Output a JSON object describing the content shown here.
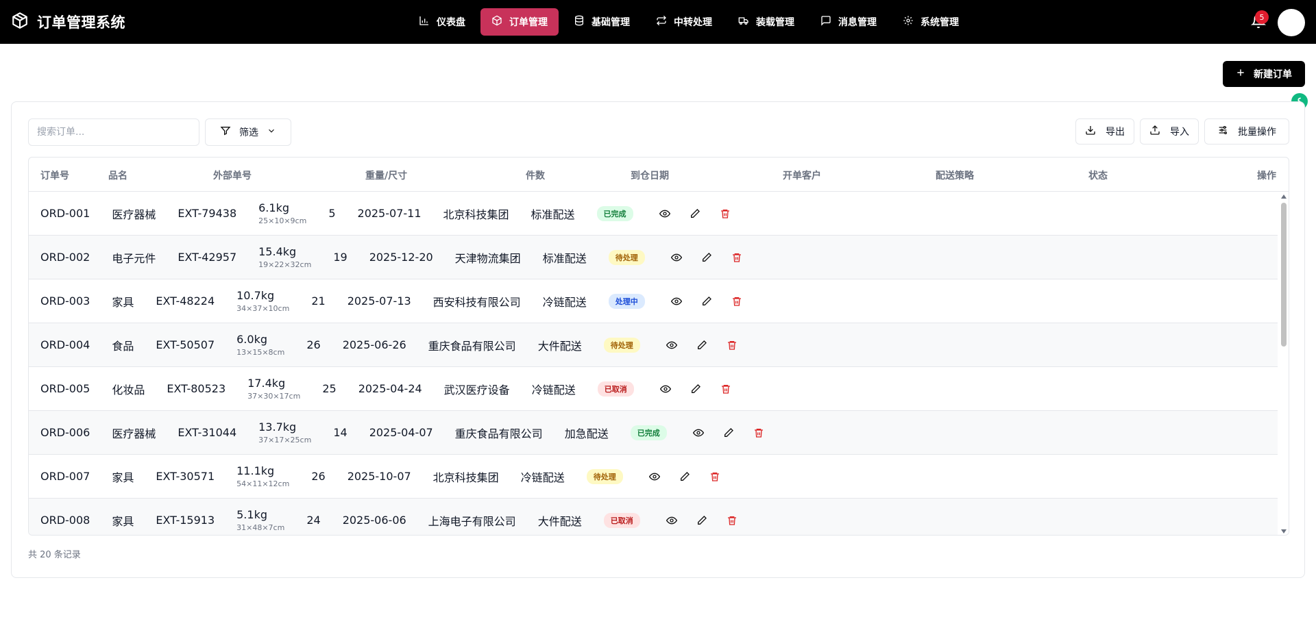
{
  "app": {
    "title": "订单管理系统"
  },
  "nav": [
    {
      "label": "仪表盘",
      "icon": "bar-chart-icon",
      "active": false
    },
    {
      "label": "订单管理",
      "icon": "box-icon",
      "active": true
    },
    {
      "label": "基础管理",
      "icon": "database-icon",
      "active": false
    },
    {
      "label": "中转处理",
      "icon": "transfer-icon",
      "active": false
    },
    {
      "label": "装载管理",
      "icon": "truck-icon",
      "active": false
    },
    {
      "label": "消息管理",
      "icon": "message-icon",
      "active": false
    },
    {
      "label": "系统管理",
      "icon": "gear-icon",
      "active": false
    }
  ],
  "notifications": {
    "count": "5"
  },
  "actions": {
    "new_order": "新建订单"
  },
  "toolbar": {
    "search_placeholder": "搜索订单...",
    "filter": "筛选",
    "export": "导出",
    "import": "导入",
    "batch": "批量操作"
  },
  "table": {
    "headers": [
      "订单号",
      "品名",
      "外部单号",
      "重量/尺寸",
      "件数",
      "到仓日期",
      "开单客户",
      "配送策略",
      "状态",
      "操作"
    ],
    "rows": [
      {
        "id": "ORD-001",
        "name": "医疗器械",
        "ext": "EXT-79438",
        "weight": "6.1kg",
        "dims": "25×10×9cm",
        "qty": "5",
        "date": "2025-07-11",
        "customer": "北京科技集团",
        "strategy": "标准配送",
        "status": "已完成",
        "status_type": "done"
      },
      {
        "id": "ORD-002",
        "name": "电子元件",
        "ext": "EXT-42957",
        "weight": "15.4kg",
        "dims": "19×22×32cm",
        "qty": "19",
        "date": "2025-12-20",
        "customer": "天津物流集团",
        "strategy": "标准配送",
        "status": "待处理",
        "status_type": "wait"
      },
      {
        "id": "ORD-003",
        "name": "家具",
        "ext": "EXT-48224",
        "weight": "10.7kg",
        "dims": "34×37×10cm",
        "qty": "21",
        "date": "2025-07-13",
        "customer": "西安科技有限公司",
        "strategy": "冷链配送",
        "status": "处理中",
        "status_type": "proc"
      },
      {
        "id": "ORD-004",
        "name": "食品",
        "ext": "EXT-50507",
        "weight": "6.0kg",
        "dims": "13×15×8cm",
        "qty": "26",
        "date": "2025-06-26",
        "customer": "重庆食品有限公司",
        "strategy": "大件配送",
        "status": "待处理",
        "status_type": "wait"
      },
      {
        "id": "ORD-005",
        "name": "化妆品",
        "ext": "EXT-80523",
        "weight": "17.4kg",
        "dims": "37×30×17cm",
        "qty": "25",
        "date": "2025-04-24",
        "customer": "武汉医疗设备",
        "strategy": "冷链配送",
        "status": "已取消",
        "status_type": "cancel"
      },
      {
        "id": "ORD-006",
        "name": "医疗器械",
        "ext": "EXT-31044",
        "weight": "13.7kg",
        "dims": "37×17×25cm",
        "qty": "14",
        "date": "2025-04-07",
        "customer": "重庆食品有限公司",
        "strategy": "加急配送",
        "status": "已完成",
        "status_type": "done"
      },
      {
        "id": "ORD-007",
        "name": "家具",
        "ext": "EXT-30571",
        "weight": "11.1kg",
        "dims": "54×11×12cm",
        "qty": "26",
        "date": "2025-10-07",
        "customer": "北京科技集团",
        "strategy": "冷链配送",
        "status": "待处理",
        "status_type": "wait"
      },
      {
        "id": "ORD-008",
        "name": "家具",
        "ext": "EXT-15913",
        "weight": "5.1kg",
        "dims": "31×48×7cm",
        "qty": "24",
        "date": "2025-06-06",
        "customer": "上海电子有限公司",
        "strategy": "大件配送",
        "status": "已取消",
        "status_type": "cancel"
      }
    ]
  },
  "footer": {
    "total": "共 20 条记录"
  },
  "colors": {
    "accent": "#c8325a",
    "topbar": "#000000",
    "danger": "#dc2626"
  }
}
